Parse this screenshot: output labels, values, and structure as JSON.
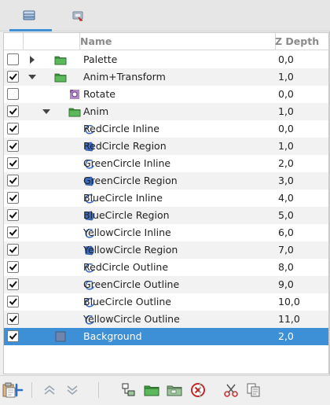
{
  "columns": {
    "name": "Name",
    "zdepth": "Z Depth"
  },
  "colors": {
    "accent": "#3d8fd6",
    "folder": "#3f9a3f",
    "shape": "#3e6ec4"
  },
  "tabs": [
    {
      "icon": "layers-panel-icon",
      "active": true
    },
    {
      "icon": "library-panel-icon",
      "active": false
    }
  ],
  "rows": [
    {
      "name": "Palette",
      "z": "0,0",
      "checked": false,
      "depth": 0,
      "kind": "group",
      "expander": "collapsed"
    },
    {
      "name": "Anim+Transform",
      "z": "1,0",
      "checked": true,
      "depth": 0,
      "kind": "group",
      "expander": "expanded"
    },
    {
      "name": "Rotate",
      "z": "0,0",
      "checked": false,
      "depth": 1,
      "kind": "rotate",
      "expander": "none"
    },
    {
      "name": "Anim",
      "z": "1,0",
      "checked": true,
      "depth": 1,
      "kind": "group",
      "expander": "expanded"
    },
    {
      "name": "RedCircle Inline",
      "z": "0,0",
      "checked": true,
      "depth": 2,
      "kind": "outline",
      "expander": "none"
    },
    {
      "name": "RedCircle Region",
      "z": "1,0",
      "checked": true,
      "depth": 2,
      "kind": "region",
      "expander": "none"
    },
    {
      "name": "GreenCircle Inline",
      "z": "2,0",
      "checked": true,
      "depth": 2,
      "kind": "outline",
      "expander": "none"
    },
    {
      "name": "GreenCircle Region",
      "z": "3,0",
      "checked": true,
      "depth": 2,
      "kind": "region",
      "expander": "none"
    },
    {
      "name": "BlueCircle Inline",
      "z": "4,0",
      "checked": true,
      "depth": 2,
      "kind": "outline",
      "expander": "none"
    },
    {
      "name": "BlueCircle Region",
      "z": "5,0",
      "checked": true,
      "depth": 2,
      "kind": "region",
      "expander": "none"
    },
    {
      "name": "YellowCircle Inline",
      "z": "6,0",
      "checked": true,
      "depth": 2,
      "kind": "outline",
      "expander": "none"
    },
    {
      "name": "YellowCircle Region",
      "z": "7,0",
      "checked": true,
      "depth": 2,
      "kind": "region",
      "expander": "none"
    },
    {
      "name": "RedCircle Outline",
      "z": "8,0",
      "checked": true,
      "depth": 2,
      "kind": "outline",
      "expander": "none"
    },
    {
      "name": "GreenCircle Outline",
      "z": "9,0",
      "checked": true,
      "depth": 2,
      "kind": "outline",
      "expander": "none"
    },
    {
      "name": "BlueCircle Outline",
      "z": "10,0",
      "checked": true,
      "depth": 2,
      "kind": "outline",
      "expander": "none"
    },
    {
      "name": "YellowCircle Outline",
      "z": "11,0",
      "checked": true,
      "depth": 2,
      "kind": "outline",
      "expander": "none"
    },
    {
      "name": "Background",
      "z": "2,0",
      "checked": true,
      "depth": 0,
      "kind": "rectangle",
      "expander": "none",
      "selected": true
    }
  ],
  "toolbar": [
    {
      "icon": "new-layer-icon"
    },
    {
      "sep": true
    },
    {
      "icon": "raise-layer-icon"
    },
    {
      "icon": "lower-layer-icon"
    },
    {
      "sep": true
    },
    {
      "icon": "duplicate-layer-icon"
    },
    {
      "icon": "encapsulate-layer-icon"
    },
    {
      "icon": "encapsulate-switch-icon"
    },
    {
      "icon": "delete-layer-icon"
    },
    {
      "sep": true
    },
    {
      "icon": "cut-icon"
    },
    {
      "icon": "copy-icon"
    },
    {
      "icon": "paste-icon"
    }
  ]
}
